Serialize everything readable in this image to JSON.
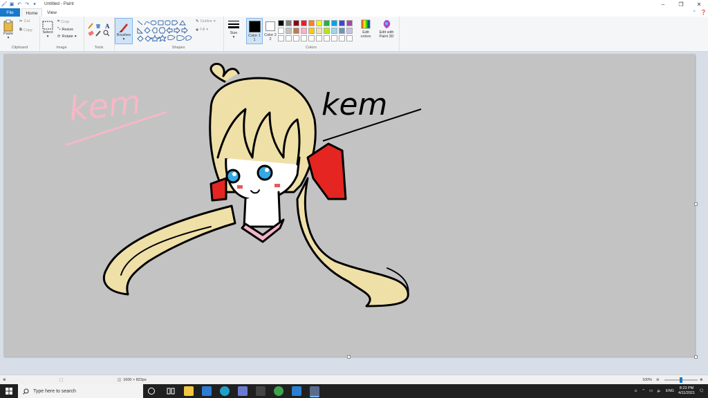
{
  "window": {
    "title": "Untitled - Paint"
  },
  "menu": {
    "file": "File",
    "home": "Home",
    "view": "View"
  },
  "ribbon": {
    "clipboard": {
      "paste": "Paste",
      "cut": "Cut",
      "copy": "Copy",
      "label": "Clipboard"
    },
    "image": {
      "select": "Select",
      "crop": "Crop",
      "resize": "Resize",
      "rotate": "Rotate",
      "label": "Image"
    },
    "tools": {
      "label": "Tools",
      "text_tool": "A"
    },
    "brushes": {
      "label": "Brushes"
    },
    "shapes": {
      "outline": "Outline",
      "fill": "Fill",
      "label": "Shapes"
    },
    "size": {
      "label": "Size"
    },
    "colors": {
      "color1": "Color 1",
      "color1_num": "1",
      "color2": "Color 2",
      "color2_num": "2",
      "edit_colors": "Edit colors",
      "edit_paint3d": "Edit with Paint 3D",
      "label": "Colors",
      "palette": [
        "#000000",
        "#7f7f7f",
        "#880015",
        "#ed1c24",
        "#ff7f27",
        "#fff200",
        "#22b14c",
        "#00a2e8",
        "#3f48cc",
        "#a349a4",
        "#ffffff",
        "#c3c3c3",
        "#b97a57",
        "#ffaec9",
        "#ffc90e",
        "#efe4b0",
        "#b5e61d",
        "#99d9ea",
        "#7092be",
        "#c8bfe7",
        "#ffffff",
        "#ffffff",
        "#ffffff",
        "#ffffff",
        "#ffffff",
        "#ffffff",
        "#ffffff",
        "#ffffff",
        "#ffffff",
        "#ffffff"
      ]
    }
  },
  "canvas": {
    "background": "#c3c3c3",
    "text_left": "kem",
    "text_right": "kem"
  },
  "status": {
    "dimensions": "1600 × 822px",
    "zoom": "100%"
  },
  "taskbar": {
    "search_placeholder": "Type here to search",
    "language": "ENG",
    "time": "8:23 PM",
    "date": "4/11/2021"
  }
}
